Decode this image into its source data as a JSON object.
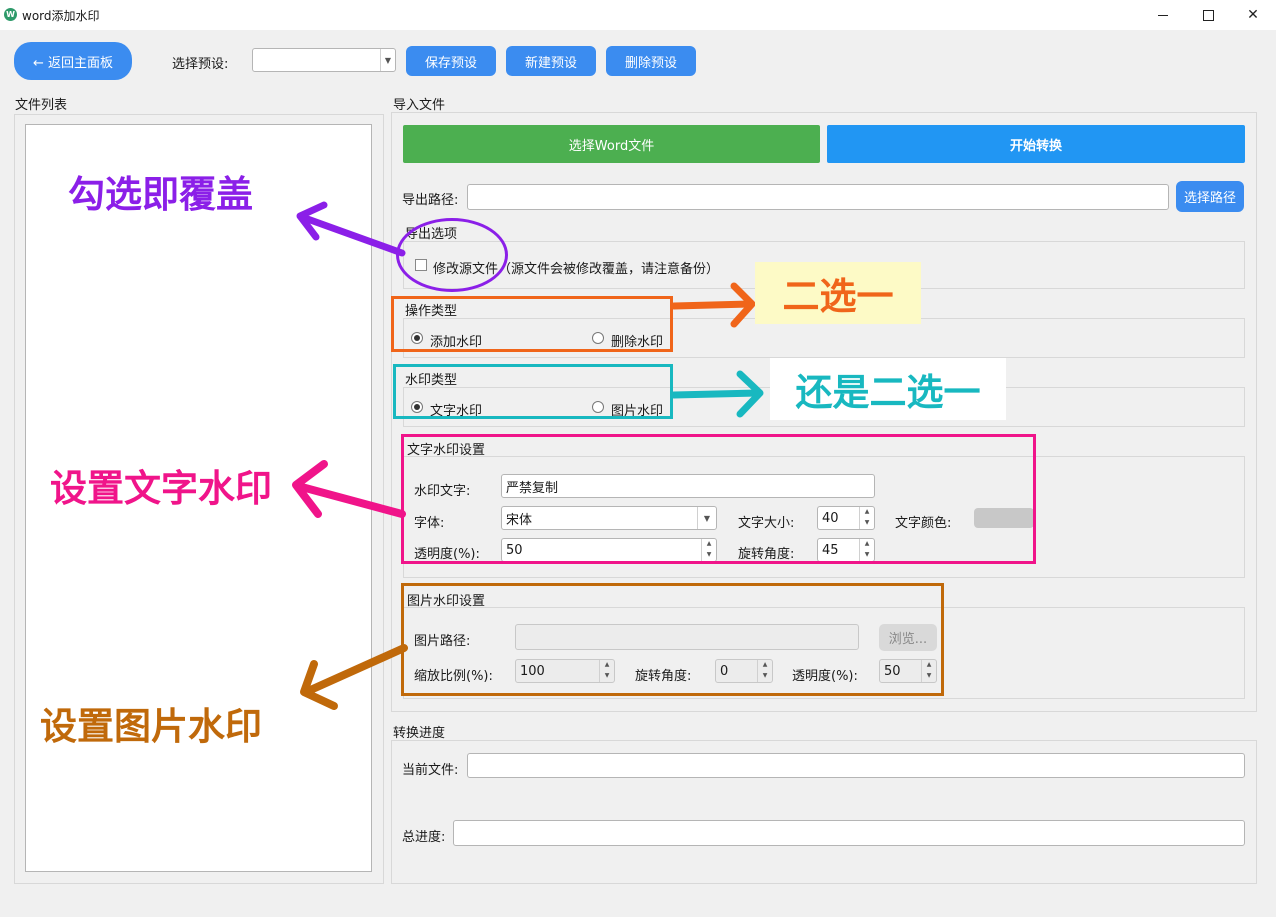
{
  "window": {
    "title": "word添加水印",
    "logo_glyph": "W",
    "controls": {
      "minimize": "—",
      "maximize": "□",
      "close": "✕"
    }
  },
  "toolbar": {
    "back_label": "← 返回主面板",
    "preset_label": "选择预设:",
    "preset_value": "",
    "save_label": "保存预设",
    "new_label": "新建预设",
    "delete_label": "删除预设"
  },
  "file_list": {
    "title": "文件列表"
  },
  "import": {
    "title": "导入文件",
    "select_word_label": "选择Word文件",
    "start_label": "开始转换",
    "export_path_label": "导出路径:",
    "export_path_value": "",
    "choose_path_label": "选择路径"
  },
  "export_options": {
    "title": "导出选项",
    "modify_source_label": "修改源文件（源文件会被修改覆盖，请注意备份）",
    "modify_source_checked": false
  },
  "operation_type": {
    "title": "操作类型",
    "add_label": "添加水印",
    "remove_label": "删除水印",
    "selected": "add"
  },
  "watermark_type": {
    "title": "水印类型",
    "text_label": "文字水印",
    "image_label": "图片水印",
    "selected": "text"
  },
  "text_settings": {
    "title": "文字水印设置",
    "text_label": "水印文字:",
    "text_value": "严禁复制",
    "font_label": "字体:",
    "font_value": "宋体",
    "size_label": "文字大小:",
    "size_value": "40",
    "color_label": "文字颜色:",
    "color_value": "#c8c8c8",
    "opacity_label": "透明度(%):",
    "opacity_value": "50",
    "rotation_label": "旋转角度:",
    "rotation_value": "45"
  },
  "image_settings": {
    "title": "图片水印设置",
    "path_label": "图片路径:",
    "path_value": "",
    "browse_label": "浏览...",
    "scale_label": "缩放比例(%):",
    "scale_value": "100",
    "rotation_label": "旋转角度:",
    "rotation_value": "0",
    "opacity_label": "透明度(%):",
    "opacity_value": "50"
  },
  "progress": {
    "title": "转换进度",
    "current_label": "当前文件:",
    "current_value": "",
    "total_label": "总进度:",
    "total_value": ""
  },
  "annotations": {
    "overwrite": "勾选即覆盖",
    "pick_one": "二选一",
    "pick_one_again": "还是二选一",
    "text_watermark": "设置文字水印",
    "image_watermark": "设置图片水印",
    "colors": {
      "purple": "#8b1fe8",
      "orange": "#f0651a",
      "teal": "#18b8c0",
      "pink": "#f0148a",
      "brown": "#c0690a"
    }
  }
}
